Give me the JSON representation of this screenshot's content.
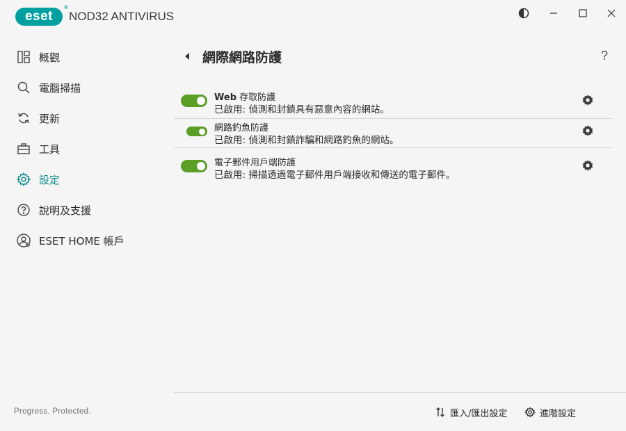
{
  "app": {
    "brand": "eset",
    "product": "NOD32 ANTIVIRUS",
    "accent_color": "#00a0a0",
    "toggle_color": "#5a9e26"
  },
  "window_controls": {
    "theme_icon": "contrast-icon",
    "minimize_icon": "minimize-icon",
    "maximize_icon": "maximize-icon",
    "close_icon": "close-icon"
  },
  "sidebar": {
    "items": [
      {
        "label": "概觀",
        "icon": "overview-icon",
        "active": false
      },
      {
        "label": "電腦掃描",
        "icon": "search-icon",
        "active": false
      },
      {
        "label": "更新",
        "icon": "refresh-icon",
        "active": false
      },
      {
        "label": "工具",
        "icon": "toolbox-icon",
        "active": false
      },
      {
        "label": "設定",
        "icon": "gear-icon",
        "active": true
      },
      {
        "label": "說明及支援",
        "icon": "help-icon",
        "active": false
      },
      {
        "label": "ESET HOME 帳戶",
        "icon": "account-icon",
        "active": false
      }
    ],
    "tagline": "Progress. Protected."
  },
  "main": {
    "title": "網際網路防護",
    "help_label": "?",
    "rows": [
      {
        "title_bold": "Web",
        "title_rest": " 存取防護",
        "desc": "已啟用: 偵測和封鎖具有惡意內容的網站。",
        "enabled": true
      },
      {
        "title_bold": "",
        "title_rest": "網路釣魚防護",
        "desc": "已啟用: 偵測和封鎖詐騙和網路釣魚的網站。",
        "enabled": true
      },
      {
        "title_bold": "",
        "title_rest": "電子郵件用戶端防護",
        "desc": "已啟用: 掃描透過電子郵件用戶端接收和傳送的電子郵件。",
        "enabled": true
      }
    ]
  },
  "footer": {
    "import_export_label": "匯入/匯出設定",
    "advanced_label": "進階設定"
  }
}
